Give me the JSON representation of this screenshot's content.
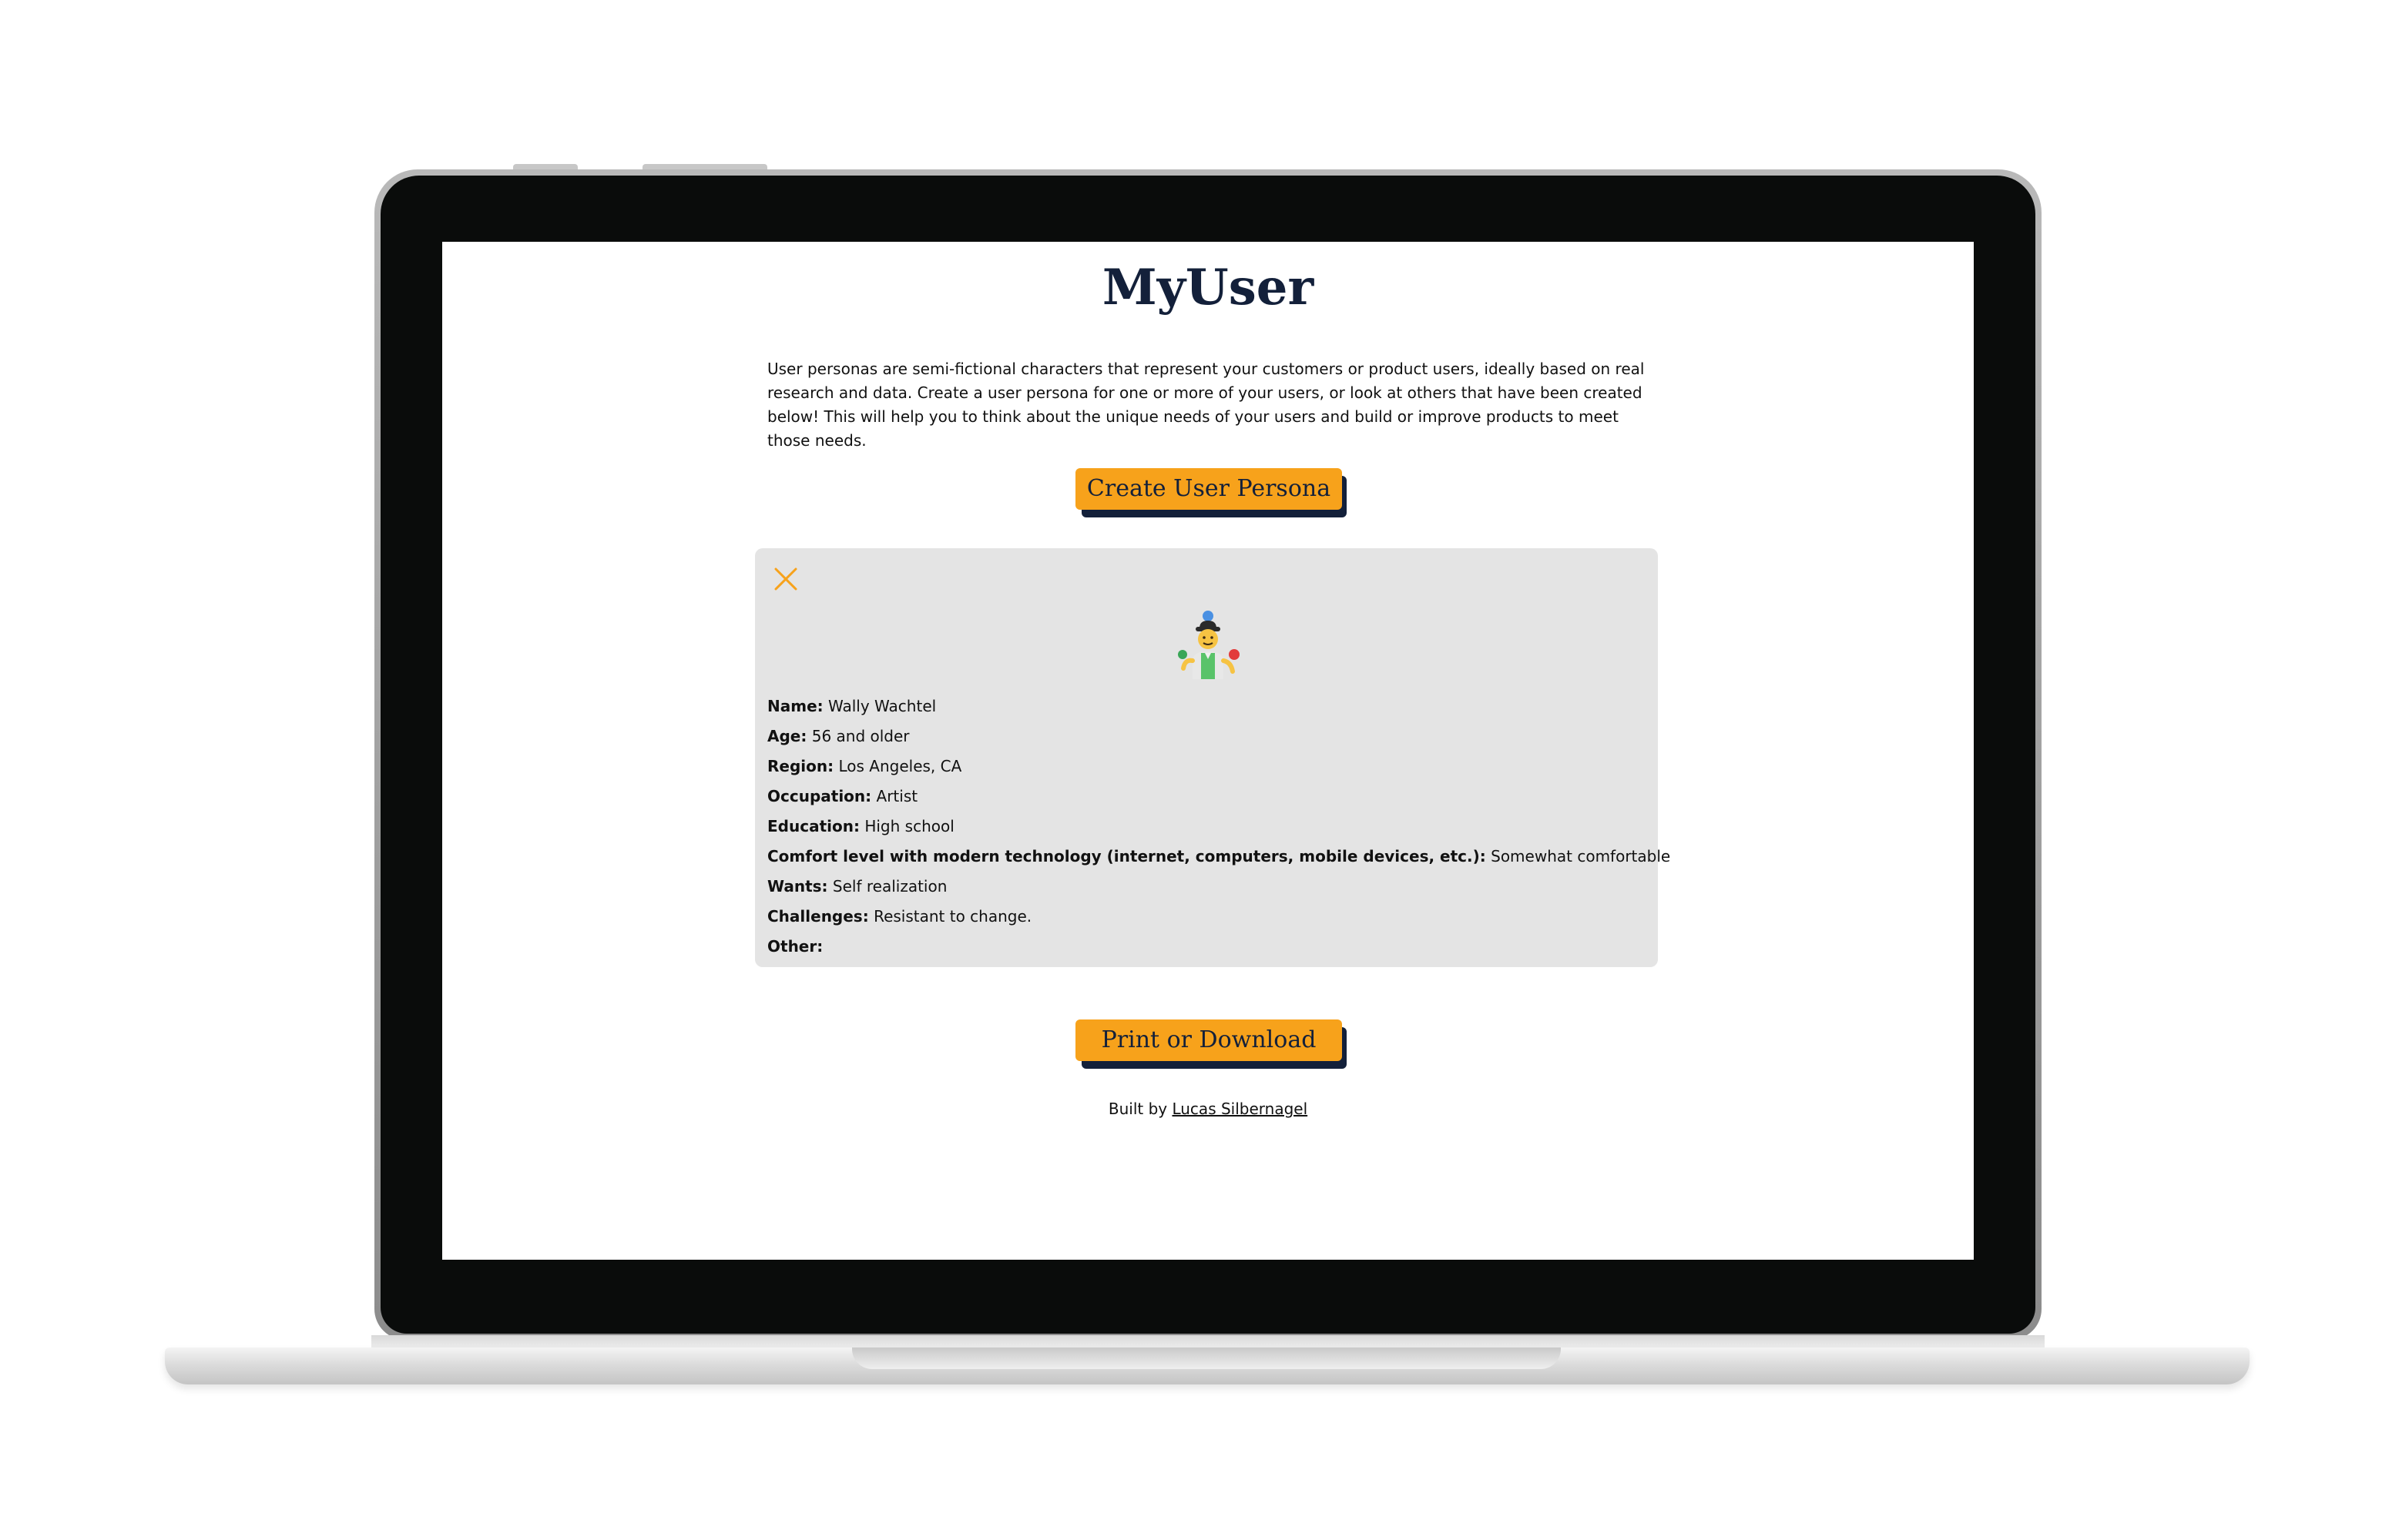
{
  "app": {
    "title": "MyUser",
    "intro": "User personas are semi-fictional characters that represent your customers or product users, ideally based on real research and data. Create a user persona for one or more of your users, or look at others that have been created below! This will help you to think about the unique needs of your users and build or improve products to meet those needs.",
    "create_button_label": "Create User Persona",
    "print_button_label": "Print or Download"
  },
  "persona": {
    "avatar_icon": "man-juggling-icon",
    "close_icon": "close-icon",
    "fields": [
      {
        "label": "Name:",
        "value": "Wally Wachtel"
      },
      {
        "label": "Age:",
        "value": "56 and older"
      },
      {
        "label": "Region:",
        "value": "Los Angeles, CA"
      },
      {
        "label": "Occupation:",
        "value": "Artist"
      },
      {
        "label": "Education:",
        "value": "High school"
      },
      {
        "label": "Comfort level with modern technology (internet, computers, mobile devices, etc.):",
        "value": "Somewhat comfortable"
      },
      {
        "label": "Wants:",
        "value": "Self realization"
      },
      {
        "label": "Challenges:",
        "value": "Resistant to change."
      },
      {
        "label": "Other:",
        "value": ""
      }
    ]
  },
  "footer": {
    "prefix": "Built by",
    "author_link": "Lucas Silbernagel"
  },
  "colors": {
    "accent": "#f7a21b",
    "navy": "#13203a",
    "card_bg": "#e4e4e4",
    "bezel": "#0a0c0b"
  }
}
